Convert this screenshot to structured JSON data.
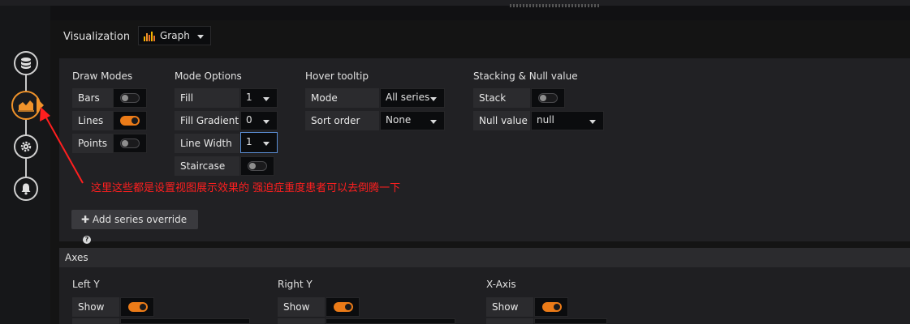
{
  "visualization": {
    "label": "Visualization",
    "selected": "Graph",
    "icon": "bar-chart-icon"
  },
  "rail": {
    "icons": [
      "database-icon",
      "chart-area-icon",
      "gear-icon",
      "bell-icon"
    ],
    "active": 1,
    "accent": "#f0932b"
  },
  "draw_modes": {
    "title": "Draw Modes",
    "items": [
      {
        "label": "Bars",
        "on": false
      },
      {
        "label": "Lines",
        "on": true
      },
      {
        "label": "Points",
        "on": false
      }
    ]
  },
  "mode_options": {
    "title": "Mode Options",
    "fill": {
      "label": "Fill",
      "value": "1"
    },
    "fill_gradient": {
      "label": "Fill Gradient",
      "value": "0"
    },
    "line_width": {
      "label": "Line Width",
      "value": "1"
    },
    "staircase": {
      "label": "Staircase",
      "on": false
    }
  },
  "hover_tooltip": {
    "title": "Hover tooltip",
    "mode": {
      "label": "Mode",
      "value": "All series"
    },
    "sort_order": {
      "label": "Sort order",
      "value": "None"
    }
  },
  "stacking": {
    "title": "Stacking & Null value",
    "stack": {
      "label": "Stack",
      "on": false
    },
    "null_value": {
      "label": "Null value",
      "value": "null"
    }
  },
  "annotation": {
    "text": "这里这些都是设置视图展示效果的 强迫症重度患者可以去倒腾一下",
    "color": "#ff1f1f"
  },
  "add_override": {
    "label": "Add series override"
  },
  "axes": {
    "title": "Axes",
    "left_y": {
      "title": "Left Y",
      "show_label": "Show",
      "on": true
    },
    "right_y": {
      "title": "Right Y",
      "show_label": "Show",
      "on": true
    },
    "x_axis": {
      "title": "X-Axis",
      "show_label": "Show",
      "on": true
    }
  },
  "colors": {
    "toggle_on": "#eb7b18",
    "background": "#111113"
  }
}
